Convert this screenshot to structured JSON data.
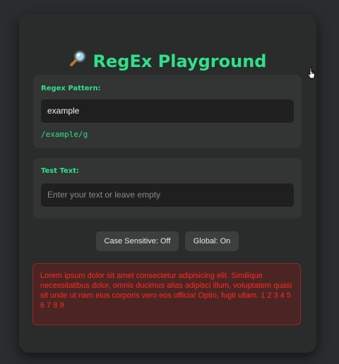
{
  "app": {
    "title": "RegEx Playground",
    "title_icon": "magnifying-glass-icon"
  },
  "pattern_section": {
    "label": "Regex Pattern:",
    "value": "example",
    "regex_display": "/example/g"
  },
  "test_section": {
    "label": "Test Text:",
    "placeholder": "Enter your text or leave empty",
    "value": ""
  },
  "toggles": {
    "case_label": "Case Sensitive: Off",
    "global_label": "Global: On"
  },
  "result": {
    "text": "Lorem ipsum dolor sit amet consectetur adipisicing elit. Similique necessitatibus dolor, omnis ducimus alias adipisci illum, voluptatem quasi sit unde ut nam eius corporis vero eos officia! Optio, fugit ullam. 1 2 3 4 5 6 7 8 9"
  },
  "colors": {
    "accent": "#2fe08a",
    "background": "#2b2c2d",
    "card": "#2a2b2b",
    "error_text": "#ff2a1f",
    "error_bg": "#4b2524"
  }
}
